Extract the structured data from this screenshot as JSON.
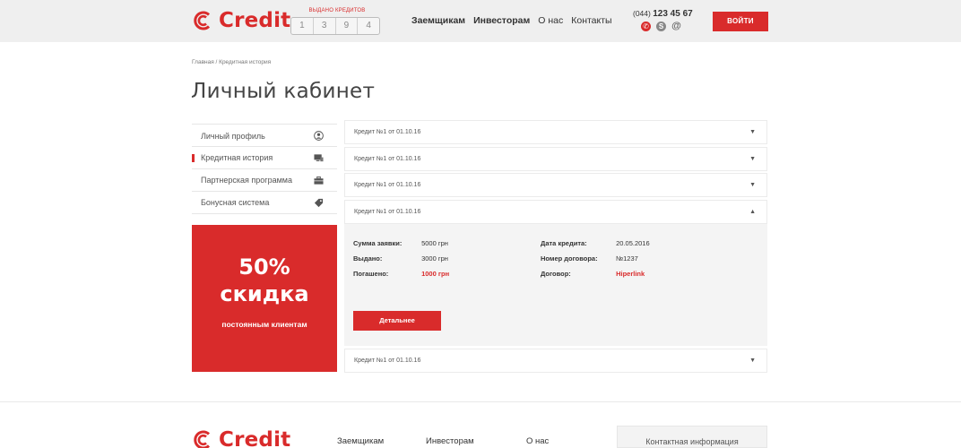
{
  "header": {
    "logo_text": "Credit",
    "counter_caption": "ВЫДАНО КРЕДИТОВ",
    "counter_digits": [
      "1",
      "3",
      "9",
      "4"
    ],
    "nav": [
      "Заемщикам",
      "Инвесторам",
      "О нас",
      "Контакты"
    ],
    "phone_code": "(044)",
    "phone_number": "123 45 67",
    "login_label": "ВОЙТИ"
  },
  "breadcrumb": "Главная / Кредитная история",
  "page_title": "Личный кабинет",
  "sidebar": {
    "items": [
      {
        "label": "Личный профиль",
        "icon": "user-icon"
      },
      {
        "label": "Кредитная история",
        "icon": "monitor-icon"
      },
      {
        "label": "Партнерская программа",
        "icon": "briefcase-icon"
      },
      {
        "label": "Бонусная система",
        "icon": "tag-icon"
      }
    ],
    "active_index": 1
  },
  "promo": {
    "percent": "50%",
    "word": "скидка",
    "sub": "постоянным клиентам"
  },
  "credits": [
    {
      "title": "Кредит №1 от 01.10.16",
      "expanded": false
    },
    {
      "title": "Кредит №1 от 01.10.16",
      "expanded": false
    },
    {
      "title": "Кредит №1 от 01.10.16",
      "expanded": false
    },
    {
      "title": "Кредит №1 от 01.10.16",
      "expanded": true
    },
    {
      "title": "Кредит №1 от 01.10.16",
      "expanded": false
    }
  ],
  "details": {
    "amount_label": "Сумма заявки:",
    "amount_value": "5000 грн",
    "issued_label": "Выдано:",
    "issued_value": "3000 грн",
    "repaid_label": "Погашено:",
    "repaid_value": "1000 грн",
    "date_label": "Дата кредита:",
    "date_value": "20.05.2016",
    "contract_no_label": "Номер договора:",
    "contract_no_value": "№1237",
    "contract_label": "Договор:",
    "contract_value": "Hiperlink",
    "more_label": "Детальнее"
  },
  "footer": {
    "logo_text": "Credit",
    "nav": [
      "Заемщикам",
      "Инвесторам",
      "О нас"
    ],
    "contact_info": "Контактная информация"
  },
  "colors": {
    "accent": "#d92b2b",
    "header_bg": "#efefef"
  }
}
